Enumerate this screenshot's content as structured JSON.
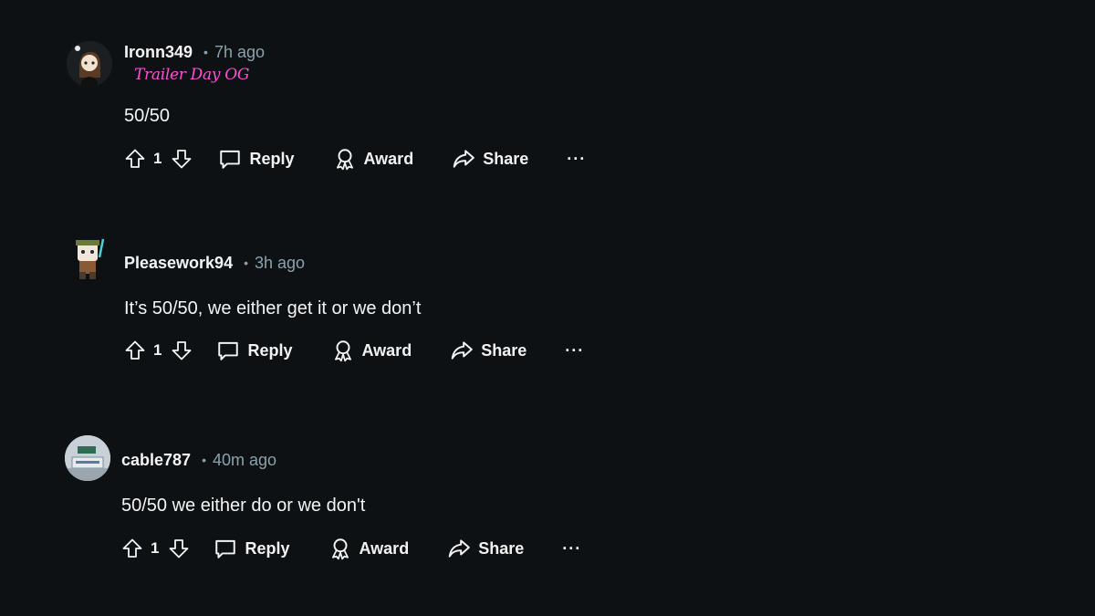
{
  "comments": [
    {
      "username": "Ironn349",
      "separator": "•",
      "time": "7h ago",
      "flair": "Trailer Day OG",
      "text": "50/50",
      "score": "1",
      "actions": {
        "reply": "Reply",
        "award": "Award",
        "share": "Share",
        "more": "···"
      }
    },
    {
      "username": "Pleasework94",
      "separator": "•",
      "time": "3h ago",
      "flair": "",
      "text": "It’s 50/50, we either get it or we don’t",
      "score": "1",
      "actions": {
        "reply": "Reply",
        "award": "Award",
        "share": "Share",
        "more": "···"
      }
    },
    {
      "username": "cable787",
      "separator": "•",
      "time": "40m ago",
      "flair": "",
      "text": "50/50 we either do or we don't",
      "score": "1",
      "actions": {
        "reply": "Reply",
        "award": "Award",
        "share": "Share",
        "more": "···"
      }
    }
  ],
  "colors": {
    "background": "#0e1113",
    "text": "#f2f4f5",
    "muted": "#8ba2ad",
    "flair": "#ff4fd8"
  },
  "icons": [
    "upvote-icon",
    "downvote-icon",
    "reply-icon",
    "award-icon",
    "share-icon",
    "more-icon"
  ]
}
